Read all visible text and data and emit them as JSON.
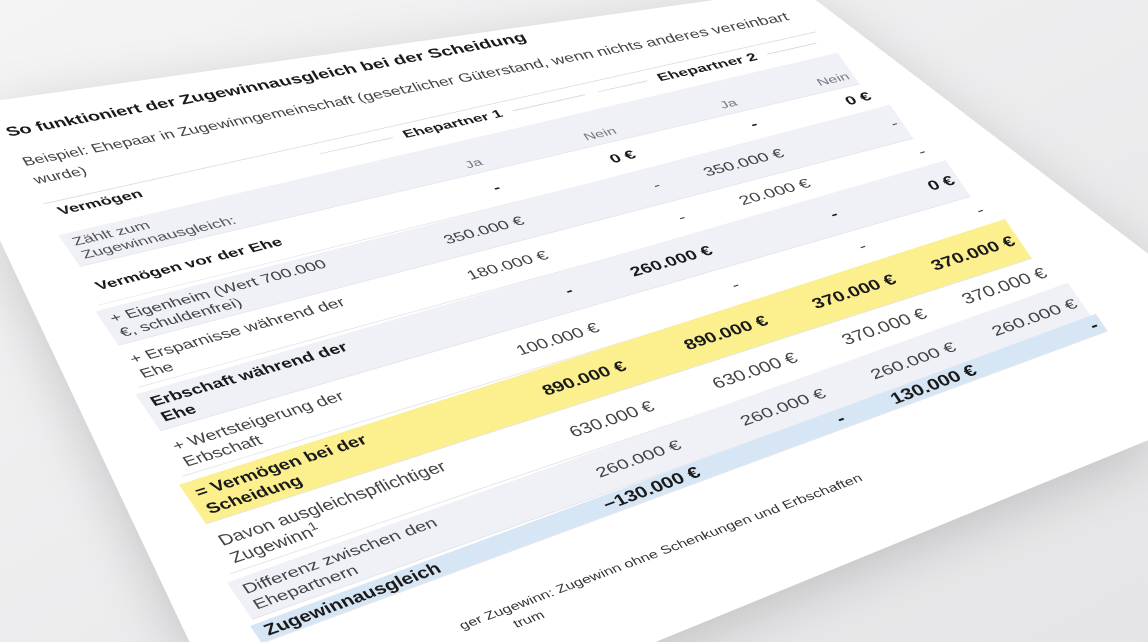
{
  "title": "So funktioniert der Zugewinnausgleich bei der Scheidung",
  "subtitle": "Beispiel: Ehepaar in Zugewinngemeinschaft (gesetzlicher Güterstand, wenn nichts anderes vereinbart wurde)",
  "table": {
    "header": {
      "label": "Vermögen",
      "groups": [
        "Ehepartner 1",
        "Ehepartner 2"
      ]
    },
    "subheader": {
      "label": "Zählt zum Zugewinnausgleich:",
      "columns": [
        "Ja",
        "Nein",
        "Ja",
        "Nein"
      ]
    },
    "rows": [
      {
        "kind": "group",
        "label": "Vermögen vor der Ehe",
        "values": [
          "-",
          "0 €",
          "-",
          "0 €"
        ]
      },
      {
        "kind": "item",
        "label": "+ Eigenheim (Wert 700.000 €, schuldenfrei)",
        "values": [
          "350.000 €",
          "-",
          "350.000 €",
          "-"
        ]
      },
      {
        "kind": "item",
        "label": "+ Ersparnisse während der Ehe",
        "values": [
          "180.000 €",
          "-",
          "20.000 €",
          "-"
        ]
      },
      {
        "kind": "group",
        "label": "Erbschaft während der Ehe",
        "values": [
          "-",
          "260.000 €",
          "-",
          "0 €"
        ]
      },
      {
        "kind": "item",
        "label": "+ Wertsteigerung der Erbschaft",
        "values": [
          "100.000 €",
          "-",
          "-",
          "-"
        ]
      },
      {
        "kind": "total",
        "label": "= Vermögen bei der Scheidung",
        "values": [
          "890.000 €",
          "890.000 €",
          "370.000 €",
          "370.000 €"
        ]
      },
      {
        "kind": "item",
        "label": "Davon ausgleichspflichtiger Zugewinn$^{1}$",
        "values": [
          "630.000 €",
          "630.000 €",
          "370.000 €",
          "370.000 €"
        ]
      },
      {
        "kind": "item",
        "label": "Differenz zwischen den Ehepartnern",
        "values": [
          "260.000 €",
          "260.000 €",
          "260.000 €",
          "260.000 €"
        ]
      },
      {
        "kind": "result",
        "label": "Zugewinnausgleich",
        "values": [
          "−130.000 €",
          "-",
          "130.000 €",
          "-"
        ]
      }
    ]
  },
  "footnote": [
    "ger Zugewinn: Zugewinn ohne Schenkungen und Erbschaften",
    "trum"
  ]
}
